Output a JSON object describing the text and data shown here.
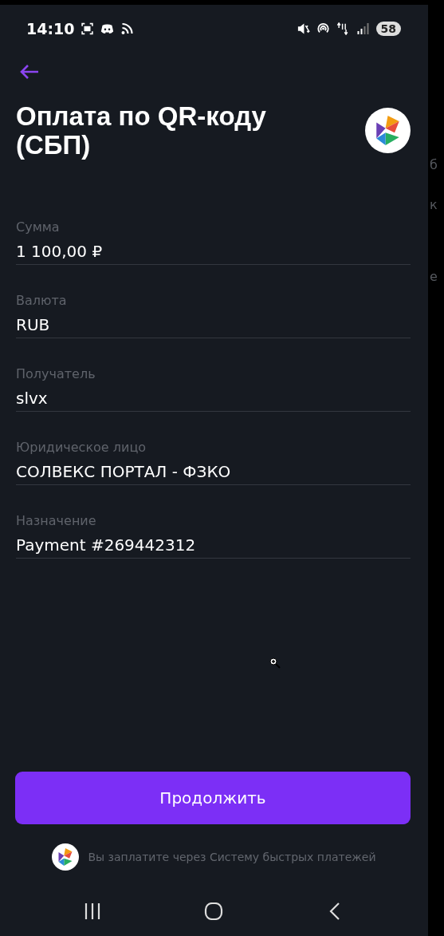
{
  "status_bar": {
    "time": "14:10",
    "battery": "58"
  },
  "title": "Оплата по QR-коду (СБП)",
  "fields": [
    {
      "label": "Сумма",
      "value": "1 100,00 ₽"
    },
    {
      "label": "Валюта",
      "value": "RUB"
    },
    {
      "label": "Получатель",
      "value": "slvx"
    },
    {
      "label": "Юридическое лицо",
      "value": "СОЛВЕКС ПОРТАЛ - ФЗКО"
    },
    {
      "label": "Назначение",
      "value": "Payment #269442312"
    }
  ],
  "primary_button": "Продолжить",
  "footer_note": "Вы заплатите через Систему быстрых платежей",
  "background_fragments": [
    "б",
    "к",
    "е"
  ]
}
